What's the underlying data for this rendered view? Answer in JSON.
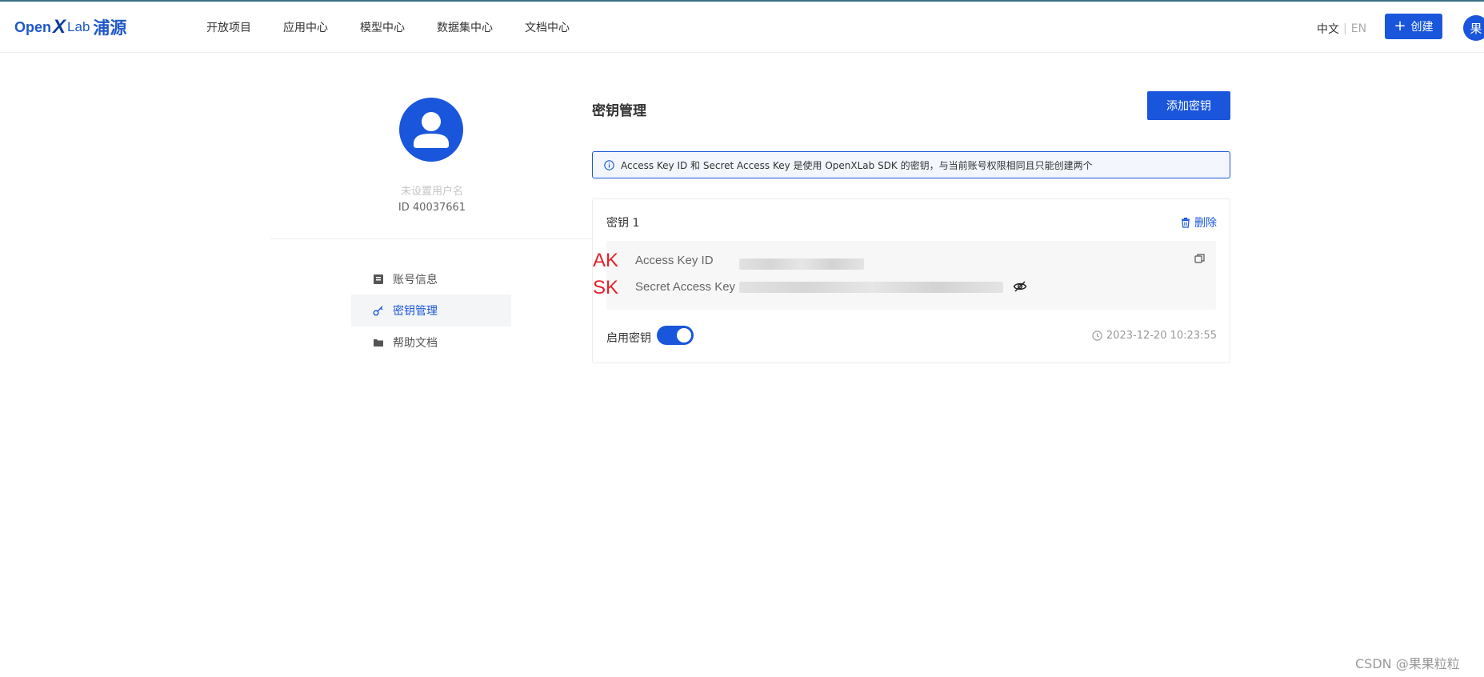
{
  "header": {
    "logo": {
      "open": "Open",
      "x": "X",
      "lab": "Lab",
      "cn": "浦源"
    },
    "nav": [
      "开放项目",
      "应用中心",
      "模型中心",
      "数据集中心",
      "文档中心"
    ],
    "lang": {
      "zh": "中文",
      "sep": "|",
      "en": "EN"
    },
    "create_label": "创建",
    "avatar_text": "果"
  },
  "profile": {
    "username": "未设置用户名",
    "user_id": "ID 40037661"
  },
  "sidebar": {
    "items": [
      {
        "label": "账号信息",
        "icon": "account-book-icon"
      },
      {
        "label": "密钥管理",
        "icon": "key-icon"
      },
      {
        "label": "帮助文档",
        "icon": "folder-icon"
      }
    ],
    "active_index": 1
  },
  "main": {
    "title": "密钥管理",
    "add_key_label": "添加密钥",
    "info_text": "Access Key ID 和 Secret Access Key 是使用 OpenXLab SDK 的密钥，与当前账号权限相同且只能创建两个",
    "key_card": {
      "title": "密钥 1",
      "delete_label": "删除",
      "ak_tag": "AK",
      "sk_tag": "SK",
      "ak_label": "Access Key ID",
      "sk_label": "Secret Access Key",
      "enable_label": "启用密钥",
      "enabled": true,
      "timestamp": "2023-12-20 10:23:55"
    }
  },
  "colors": {
    "accent": "#1a56db",
    "annotation_red": "#e3232b"
  },
  "watermark": "CSDN @果果粒粒"
}
